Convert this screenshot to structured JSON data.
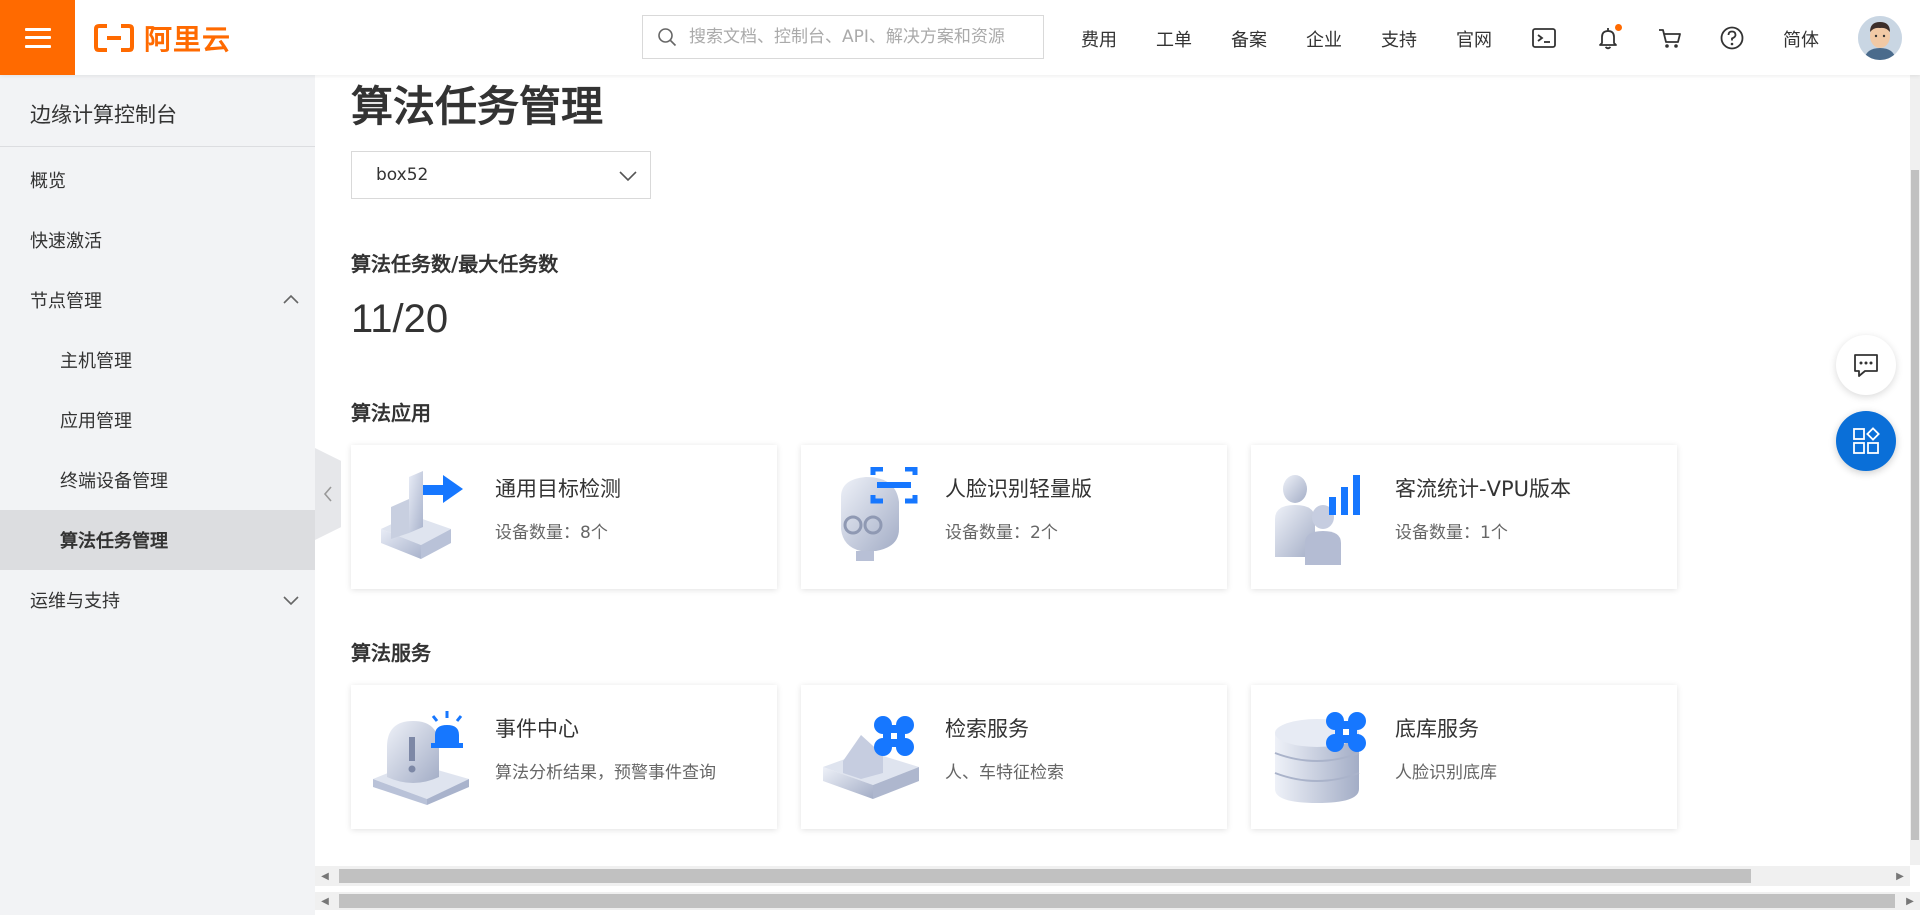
{
  "brand": {
    "name": "阿里云",
    "color": "#ff6a00"
  },
  "search": {
    "placeholder": "搜索文档、控制台、API、解决方案和资源"
  },
  "nav": {
    "items": [
      "费用",
      "工单",
      "备案",
      "企业",
      "支持",
      "官网"
    ],
    "language": "简体",
    "icons": [
      "terminal-icon",
      "bell-icon",
      "cart-icon",
      "help-icon"
    ]
  },
  "sidebar": {
    "title": "边缘计算控制台",
    "items": [
      {
        "label": "概览",
        "level": 1
      },
      {
        "label": "快速激活",
        "level": 1
      },
      {
        "label": "节点管理",
        "level": 1,
        "expanded": true
      },
      {
        "label": "主机管理",
        "level": 2
      },
      {
        "label": "应用管理",
        "level": 2
      },
      {
        "label": "终端设备管理",
        "level": 2
      },
      {
        "label": "算法任务管理",
        "level": 2,
        "active": true
      },
      {
        "label": "运维与支持",
        "level": 1,
        "expanded": false
      }
    ]
  },
  "main": {
    "title": "算法任务管理",
    "device_select": "box52",
    "task_count_label": "算法任务数/最大任务数",
    "task_count_value": "11/20",
    "apps_label": "算法应用",
    "apps": [
      {
        "title": "通用目标检测",
        "subtitle": "设备数量：8个",
        "icon": "object-detection-icon"
      },
      {
        "title": "人脸识别轻量版",
        "subtitle": "设备数量：2个",
        "icon": "face-recognition-icon"
      },
      {
        "title": "客流统计-VPU版本",
        "subtitle": "设备数量：1个",
        "icon": "people-counting-icon"
      }
    ],
    "services_label": "算法服务",
    "services": [
      {
        "title": "事件中心",
        "subtitle": "算法分析结果，预警事件查询",
        "icon": "event-alarm-icon"
      },
      {
        "title": "检索服务",
        "subtitle": "人、车特征检索",
        "icon": "search-service-icon"
      },
      {
        "title": "底库服务",
        "subtitle": "人脸识别底库",
        "icon": "database-icon"
      }
    ]
  },
  "colors": {
    "accent_blue": "#0a6fd8",
    "sidebar_bg": "#f2f3f5",
    "active_bg": "#dcdde0"
  }
}
